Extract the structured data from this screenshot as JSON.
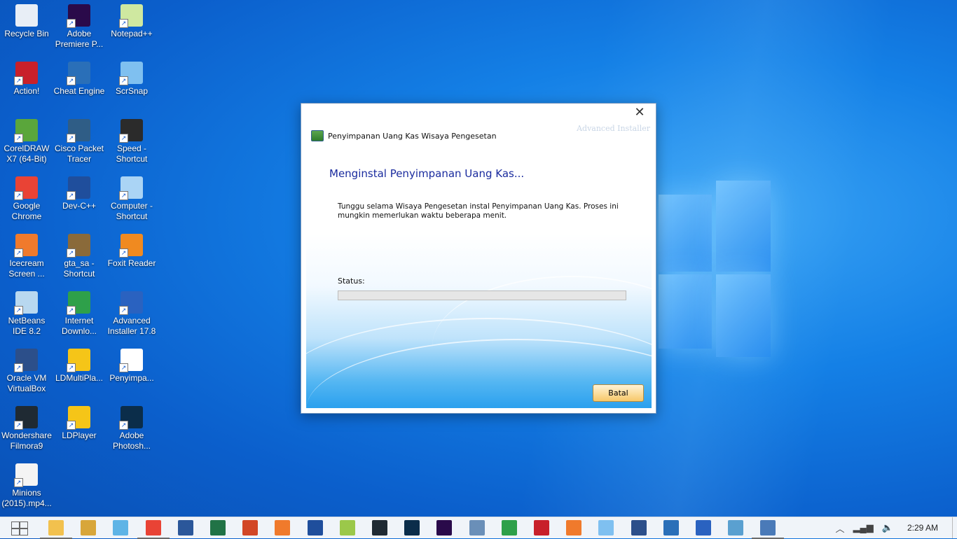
{
  "desktop": {
    "icons": [
      {
        "label": "Recycle Bin",
        "color": "#e8eef6"
      },
      {
        "label": "Adobe Premiere P...",
        "color": "#2a0a4a"
      },
      {
        "label": "Notepad++",
        "color": "#cfe8a0"
      },
      {
        "label": "Action!",
        "color": "#c8202a"
      },
      {
        "label": "Cheat Engine",
        "color": "#2a6fb8"
      },
      {
        "label": "ScrSnap",
        "color": "#7fc0f0"
      },
      {
        "label": "CorelDRAW X7 (64-Bit)",
        "color": "#5aa63b"
      },
      {
        "label": "Cisco Packet Tracer",
        "color": "#2f5d86"
      },
      {
        "label": "Speed - Shortcut",
        "color": "#2b2b2b"
      },
      {
        "label": "Google Chrome",
        "color": "#e94335"
      },
      {
        "label": "Dev-C++",
        "color": "#1f4e9c"
      },
      {
        "label": "Computer - Shortcut",
        "color": "#aad4f5"
      },
      {
        "label": "Icecream Screen ...",
        "color": "#f07a2c"
      },
      {
        "label": "gta_sa - Shortcut",
        "color": "#8a6a3a"
      },
      {
        "label": "Foxit Reader",
        "color": "#f08a20"
      },
      {
        "label": "NetBeans IDE 8.2",
        "color": "#b8d8f0"
      },
      {
        "label": "Internet Downlo...",
        "color": "#2ea04a"
      },
      {
        "label": "Advanced Installer 17.8",
        "color": "#2a62c0"
      },
      {
        "label": "Oracle VM VirtualBox",
        "color": "#2c4f8a"
      },
      {
        "label": "LDMultiPla...",
        "color": "#f5c518"
      },
      {
        "label": "Penyimpa...",
        "color": "#ffffff"
      },
      {
        "label": "Wondershare Filmora9",
        "color": "#1f2a33"
      },
      {
        "label": "LDPlayer",
        "color": "#f5c518"
      },
      {
        "label": "Adobe Photosh...",
        "color": "#0b2d4a"
      },
      {
        "label": "Minions (2015).mp4...",
        "color": "#f4f4f4"
      }
    ]
  },
  "dialog": {
    "app_title": "Penyimpanan Uang Kas Wisaya Pengesetan",
    "brand": "Advanced Installer",
    "close_glyph": "✕",
    "heading": "Menginstal Penyimpanan Uang Kas...",
    "description": "Tunggu selama Wisaya Pengesetan instal Penyimpanan Uang Kas.  Proses ini mungkin memerlukan waktu beberapa menit.",
    "status_label": "Status:",
    "progress": 0,
    "cancel_label": "Batal"
  },
  "taskbar": {
    "apps": [
      {
        "name": "file-explorer-icon",
        "color": "#f2c14e"
      },
      {
        "name": "tool-icon",
        "color": "#d8a63a"
      },
      {
        "name": "network-icon",
        "color": "#5fb4e6"
      },
      {
        "name": "chrome-icon",
        "color": "#e94335"
      },
      {
        "name": "word-icon",
        "color": "#2b579a"
      },
      {
        "name": "excel-icon",
        "color": "#217346"
      },
      {
        "name": "powerpoint-icon",
        "color": "#d24726"
      },
      {
        "name": "icecream-icon",
        "color": "#f07a2c"
      },
      {
        "name": "devcpp-icon",
        "color": "#1f4e9c"
      },
      {
        "name": "notepadpp-icon",
        "color": "#9bc84a"
      },
      {
        "name": "filmora-icon",
        "color": "#1f2a33"
      },
      {
        "name": "photoshop-icon",
        "color": "#0b2d4a"
      },
      {
        "name": "premiere-icon",
        "color": "#2a0a4a"
      },
      {
        "name": "netbeans-icon",
        "color": "#6a8fb8"
      },
      {
        "name": "idm-icon",
        "color": "#2ea04a"
      },
      {
        "name": "action-icon",
        "color": "#c8202a"
      },
      {
        "name": "xampp-icon",
        "color": "#f07a2c"
      },
      {
        "name": "scrsnap-icon",
        "color": "#7fc0f0"
      },
      {
        "name": "virtualbox-icon",
        "color": "#2c4f8a"
      },
      {
        "name": "cheat-engine-icon",
        "color": "#2a6fb8"
      },
      {
        "name": "advanced-installer-icon",
        "color": "#2a62c0"
      },
      {
        "name": "cisco-icon",
        "color": "#5aa0d0"
      },
      {
        "name": "installer-running-icon",
        "color": "#4a7ab8"
      }
    ],
    "clock": "2:29 AM"
  }
}
